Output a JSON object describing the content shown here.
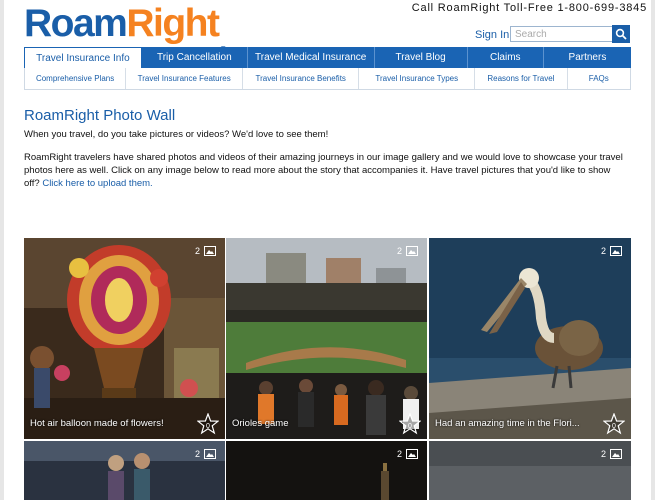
{
  "brand": {
    "name_part1": "Roam",
    "name_part2": "Right",
    "reg": "®"
  },
  "header": {
    "phone": "Call RoamRight Toll-Free 1-800-699-3845",
    "signin": "Sign In",
    "search_placeholder": "Search",
    "search_icon": "magnifier-icon"
  },
  "nav": {
    "tabs": [
      {
        "label": "Travel Insurance Info",
        "active": true
      },
      {
        "label": "Trip Cancellation"
      },
      {
        "label": "Travel Medical Insurance"
      },
      {
        "label": "Travel Blog"
      },
      {
        "label": "Claims"
      },
      {
        "label": "Partners"
      }
    ],
    "subnav": [
      "Comprehensive Plans",
      "Travel Insurance Features",
      "Travel Insurance Benefits",
      "Travel Insurance Types",
      "Reasons for Travel",
      "FAQs"
    ]
  },
  "main": {
    "title": "RoamRight Photo Wall",
    "intro": "When you travel, do you take pictures or videos? We'd love to see them!",
    "body": "RoamRight travelers have shared photos and videos of their amazing journeys in our image gallery and we would love to showcase your travel photos here as well. Click on any image below to read more about the story that accompanies it. Have travel pictures that you'd like to show off?",
    "link": "Click here to upload them."
  },
  "gallery": {
    "tiles": [
      {
        "caption": "Hot air balloon made of flowers!",
        "count": "2",
        "votes": "0"
      },
      {
        "caption": "Orioles game",
        "count": "2",
        "votes": "0"
      },
      {
        "caption": "Had an amazing time in the Flori...",
        "count": "2",
        "votes": "0"
      },
      {
        "caption": "",
        "count": "2",
        "votes": ""
      },
      {
        "caption": "",
        "count": "2",
        "votes": ""
      },
      {
        "caption": "",
        "count": "2",
        "votes": ""
      }
    ]
  },
  "colors": {
    "brand_blue": "#1a5ea8",
    "brand_orange": "#f58220",
    "nav_blue": "#1a64b4"
  }
}
